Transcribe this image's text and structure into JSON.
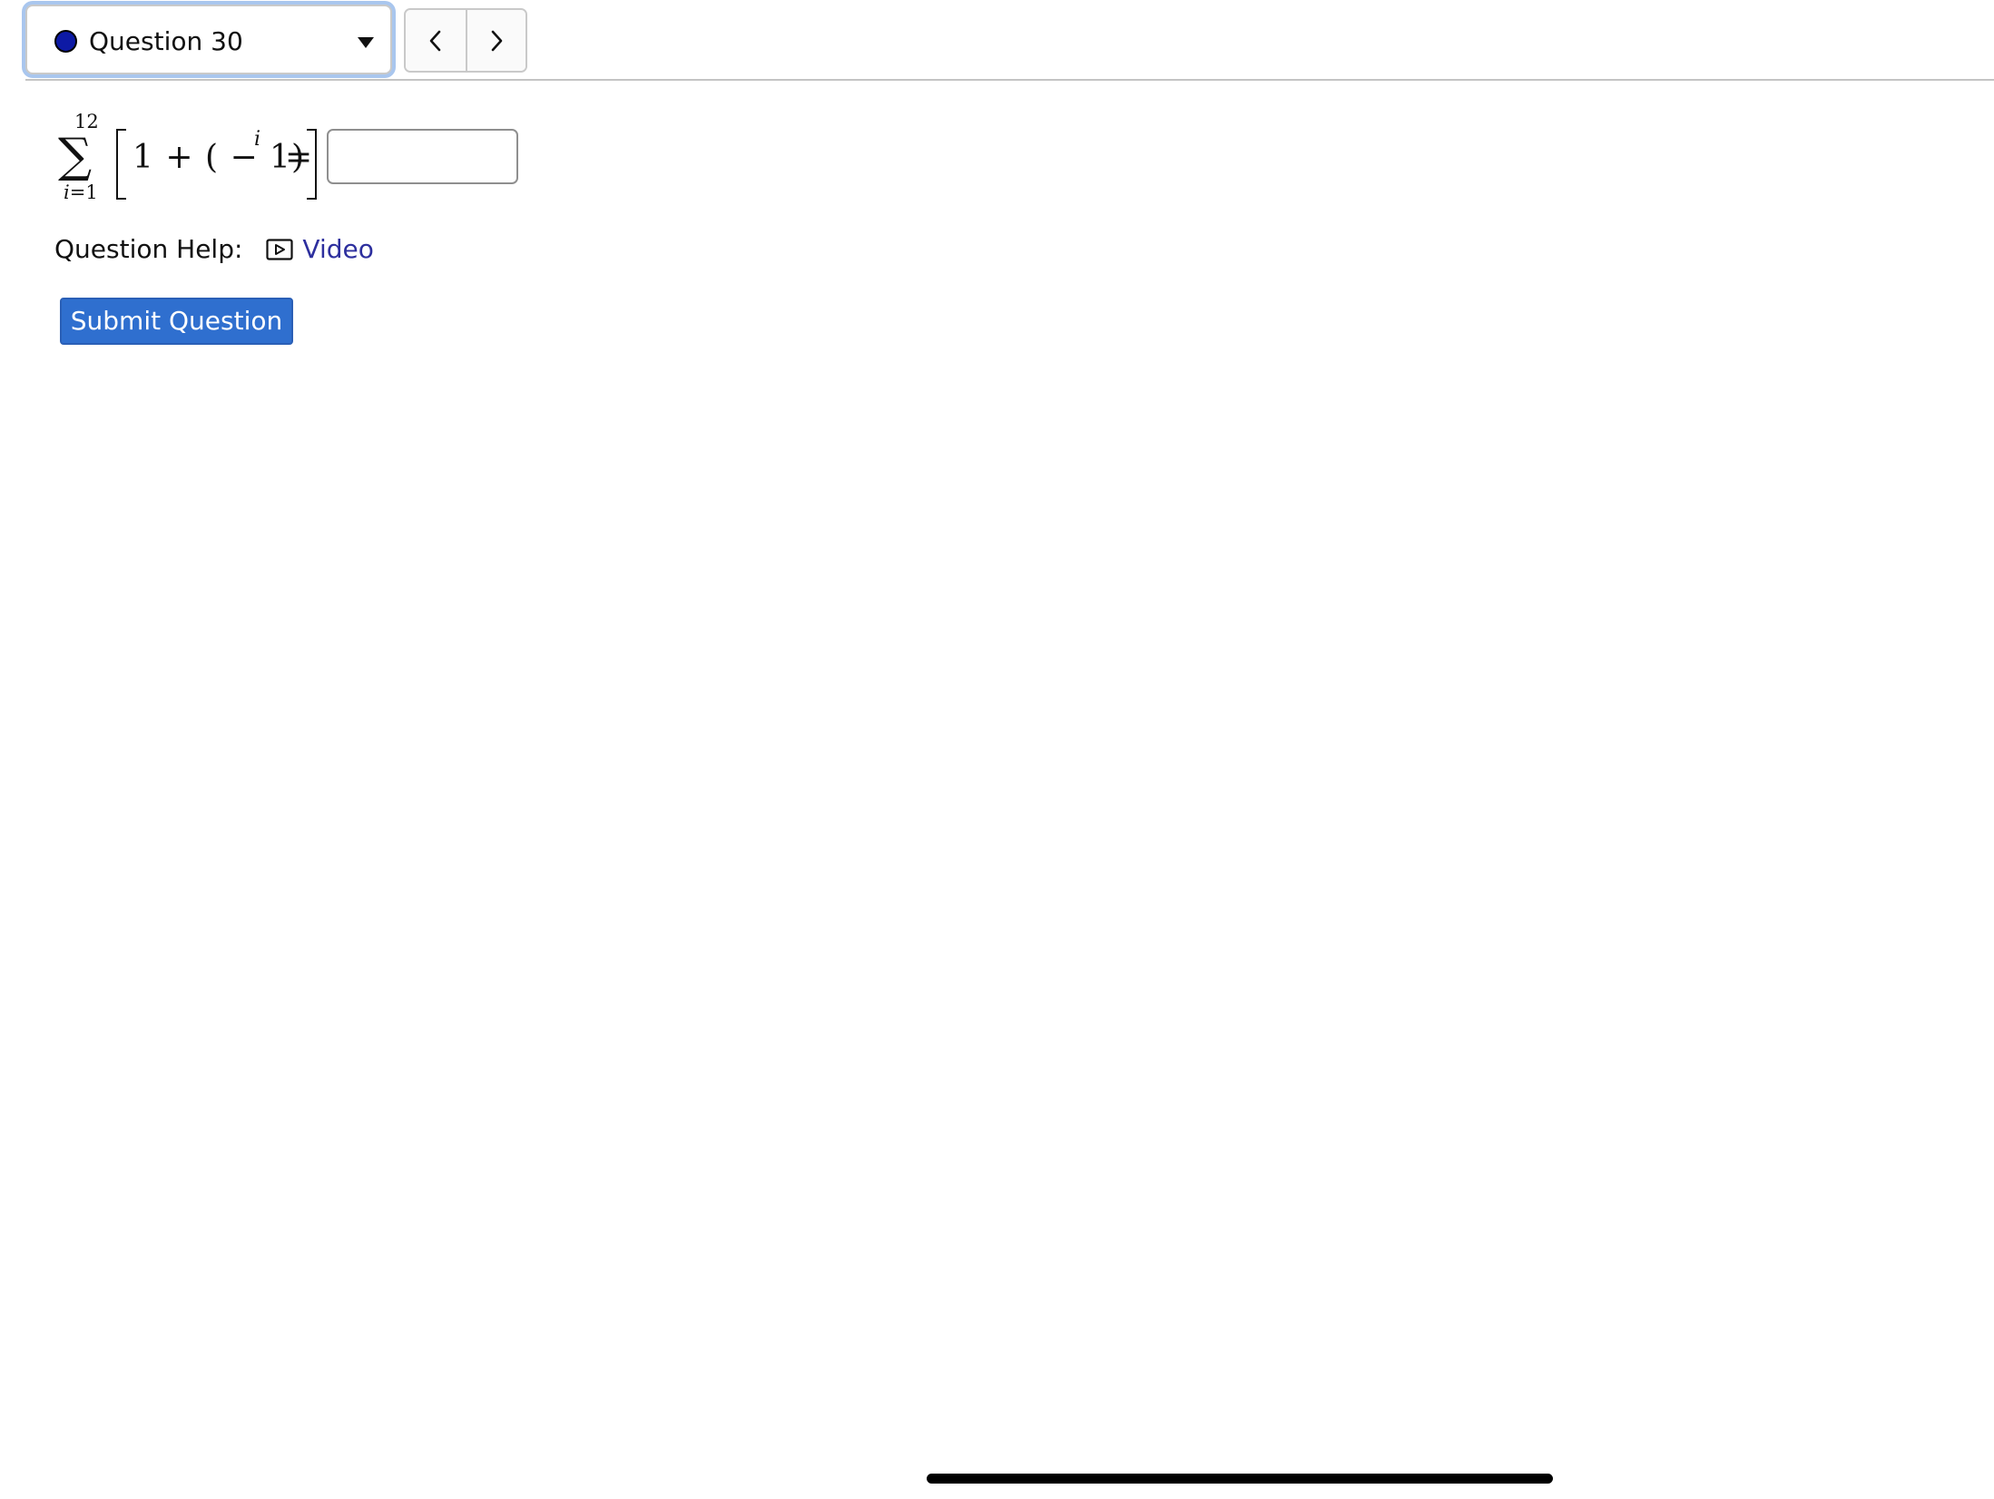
{
  "question_selector": {
    "label": "Question 30",
    "status_color": "#0d1aa5"
  },
  "navigation": {
    "prev_icon": "chevron-left-icon",
    "next_icon": "chevron-right-icon"
  },
  "equation": {
    "sum_upper": "12",
    "sum_symbol": "∑",
    "sum_index": "i",
    "sum_lower_eq": "=1",
    "expression": "1 + ( − 1)",
    "exponent": "i",
    "equals": "="
  },
  "answer": {
    "value": "",
    "placeholder": ""
  },
  "help": {
    "label": "Question Help:",
    "video_label": "Video",
    "video_icon": "video-play-icon",
    "link_color": "#2d2f9e"
  },
  "submit": {
    "label": "Submit Question",
    "color": "#2f6fcf"
  }
}
